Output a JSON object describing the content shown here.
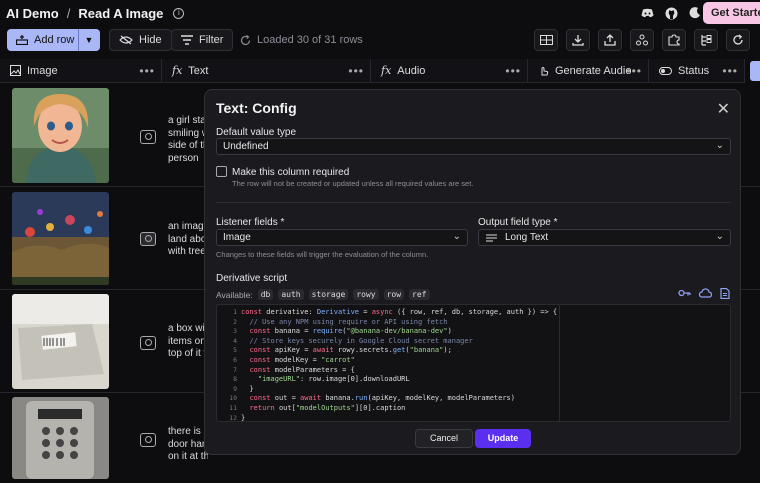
{
  "breadcrumb": {
    "project": "AI Demo",
    "separator": "/",
    "table": "Read A Image"
  },
  "header": {
    "get_started": "Get Starte"
  },
  "toolbar": {
    "add_row": "Add row",
    "hide": "Hide",
    "filter": "Filter",
    "loaded_status": "Loaded 30 of 31 rows"
  },
  "columns": [
    {
      "label": "Image",
      "icon": "image-icon"
    },
    {
      "label": "Text",
      "icon": "formula-icon"
    },
    {
      "label": "Audio",
      "icon": "formula-icon"
    },
    {
      "label": "Generate Audio",
      "icon": "action-icon"
    },
    {
      "label": "Status",
      "icon": "toggle-icon"
    }
  ],
  "rows": [
    {
      "text_lines": [
        "a girl star",
        "smiling w",
        "side of th",
        "person"
      ]
    },
    {
      "text_lines": [
        "an image",
        "land abov",
        "with trees"
      ]
    },
    {
      "text_lines": [
        "a box wit",
        "items on",
        "top of it w"
      ]
    },
    {
      "text_lines": [
        "there is a",
        "door hand",
        "on it at the bottom"
      ]
    }
  ],
  "modal": {
    "title": "Text: Config",
    "default_value_label": "Default value type",
    "default_value": "Undefined",
    "required_label": "Make this column required",
    "required_hint": "The row will not be created or updated unless all required values are set.",
    "listener_label": "Listener fields *",
    "listener_value": "Image",
    "listener_hint": "Changes to these fields will trigger the evaluation of the column.",
    "output_label": "Output field type *",
    "output_value": "Long Text",
    "script_label": "Derivative script",
    "available_label": "Available:",
    "available_vars": [
      "db",
      "auth",
      "storage",
      "rowy",
      "row",
      "ref"
    ],
    "code_line_numbers": [
      "1",
      "2",
      "3",
      "4",
      "5",
      "6",
      "7",
      "8",
      "9",
      "10",
      "11",
      "12"
    ],
    "cancel": "Cancel",
    "update": "Update"
  },
  "colors": {
    "accent": "#5a2ff0",
    "add_row_bg": "#aab7f7",
    "starter_bg": "#f9c7e6"
  }
}
